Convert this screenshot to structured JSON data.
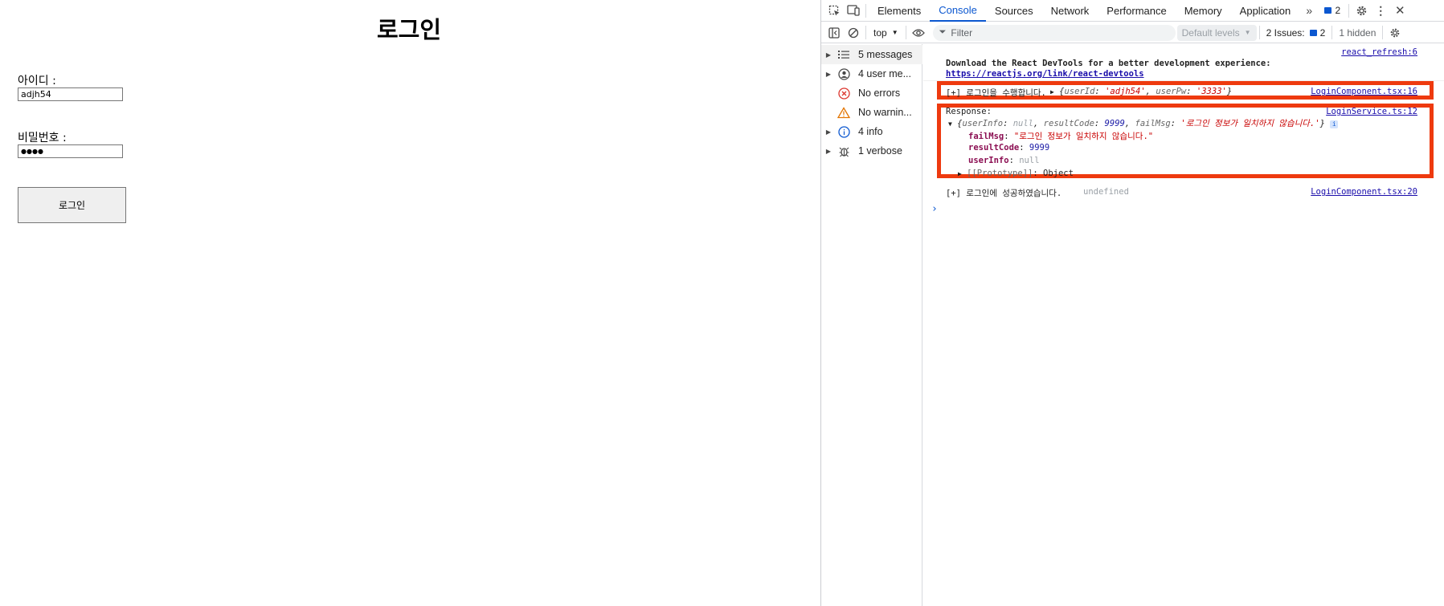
{
  "page": {
    "title": "로그인",
    "id_label": "아이디 :",
    "id_value": "adjh54",
    "pw_label": "비밀번호 :",
    "pw_value": "3333",
    "login_button": "로그인"
  },
  "devtools": {
    "tabs": [
      "Elements",
      "Console",
      "Sources",
      "Network",
      "Performance",
      "Memory",
      "Application"
    ],
    "active_tab": "Console",
    "issues_badge_count": "2",
    "toolbar": {
      "context": "top",
      "filter_placeholder": "Filter",
      "levels": "Default levels",
      "issues_label": "2 Issues:",
      "issues_count": "2",
      "hidden": "1 hidden"
    },
    "sidebar": [
      {
        "label": "5 messages",
        "icon": "list-icon",
        "expandable": true
      },
      {
        "label": "4 user me...",
        "icon": "user-icon",
        "expandable": true
      },
      {
        "label": "No errors",
        "icon": "error-icon",
        "expandable": false
      },
      {
        "label": "No warnin...",
        "icon": "warning-icon",
        "expandable": false
      },
      {
        "label": "4 info",
        "icon": "info-icon",
        "expandable": true
      },
      {
        "label": "1 verbose",
        "icon": "bug-icon",
        "expandable": true
      }
    ],
    "console": {
      "msg1_text": "Download the React DevTools for a better development experience:",
      "msg1_link": "https://reactjs.org/link/react-devtools",
      "msg1_source": "react_refresh:6",
      "msg2_prefix": "[+] 로그인을 수행합니다.",
      "msg2_obj": {
        "open": "{",
        "k1": "userId",
        "v1": "'adjh54'",
        "k2": "userPw",
        "v2": "'3333'",
        "close": "}"
      },
      "msg2_source": "LoginComponent.tsx:16",
      "msg3_label": "Response:",
      "msg3_source": "LoginService.ts:12",
      "msg3_summary": {
        "k1": "userInfo",
        "v1": "null",
        "k2": "resultCode",
        "v2": "9999",
        "k3": "failMsg",
        "v3": "'로그인 정보가 일치하지 않습니다.'"
      },
      "msg3_props": [
        {
          "key": "failMsg",
          "value": "\"로그인 정보가 일치하지 않습니다.\"",
          "kind": "str"
        },
        {
          "key": "resultCode",
          "value": "9999",
          "kind": "num"
        },
        {
          "key": "userInfo",
          "value": "null",
          "kind": "nul"
        }
      ],
      "msg3_proto_key": "[[Prototype]]",
      "msg3_proto_val": "Object",
      "msg4_text": "[+] 로그인에 성공하였습니다.",
      "msg4_value": "undefined",
      "msg4_source": "LoginComponent.tsx:20"
    },
    "highlight_color": "#ee3a0f"
  }
}
